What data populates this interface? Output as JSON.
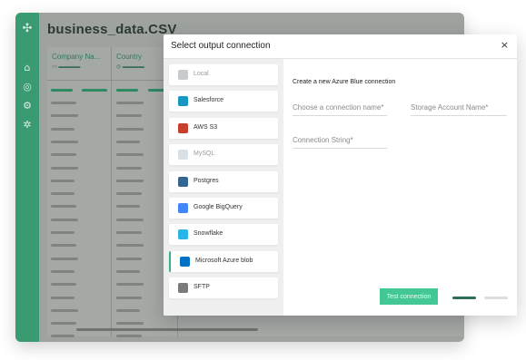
{
  "app": {
    "file_title": "business_data.CSV",
    "columns": [
      {
        "title": "Company Na...",
        "sub": "▭ ▬▬▬▬"
      },
      {
        "title": "Country",
        "sub": "◎ ▬▬▬▬"
      }
    ]
  },
  "modal": {
    "title": "Select output connection",
    "close": "×",
    "connections": [
      {
        "label": "Local",
        "icon": "layers-icon",
        "color": "#9aa0a6",
        "muted": true
      },
      {
        "label": "Salesforce",
        "icon": "salesforce-icon",
        "color": "#1798c1",
        "muted": false
      },
      {
        "label": "AWS S3",
        "icon": "aws-s3-icon",
        "color": "#c7402d",
        "muted": false
      },
      {
        "label": "MySQL",
        "icon": "mysql-icon",
        "color": "#b9c4cc",
        "muted": true
      },
      {
        "label": "Postgres",
        "icon": "postgres-icon",
        "color": "#336791",
        "muted": false
      },
      {
        "label": "Google BigQuery",
        "icon": "bigquery-icon",
        "color": "#4386fa",
        "muted": false
      },
      {
        "label": "Snowflake",
        "icon": "snowflake-icon",
        "color": "#29b5e8",
        "muted": false
      },
      {
        "label": "Microsoft Azure blob",
        "icon": "azure-blob-icon",
        "color": "#0072c6",
        "muted": false,
        "selected": true
      },
      {
        "label": "SFTP",
        "icon": "sftp-icon",
        "color": "#7a7a7a",
        "muted": false
      }
    ],
    "form": {
      "heading": "Create a new Azure Blue connection",
      "connection_name_placeholder": "Choose a connection name*",
      "storage_account_placeholder": "Storage Account Name*",
      "connection_string_placeholder": "Connection String*",
      "test_button": "Test connection"
    }
  }
}
